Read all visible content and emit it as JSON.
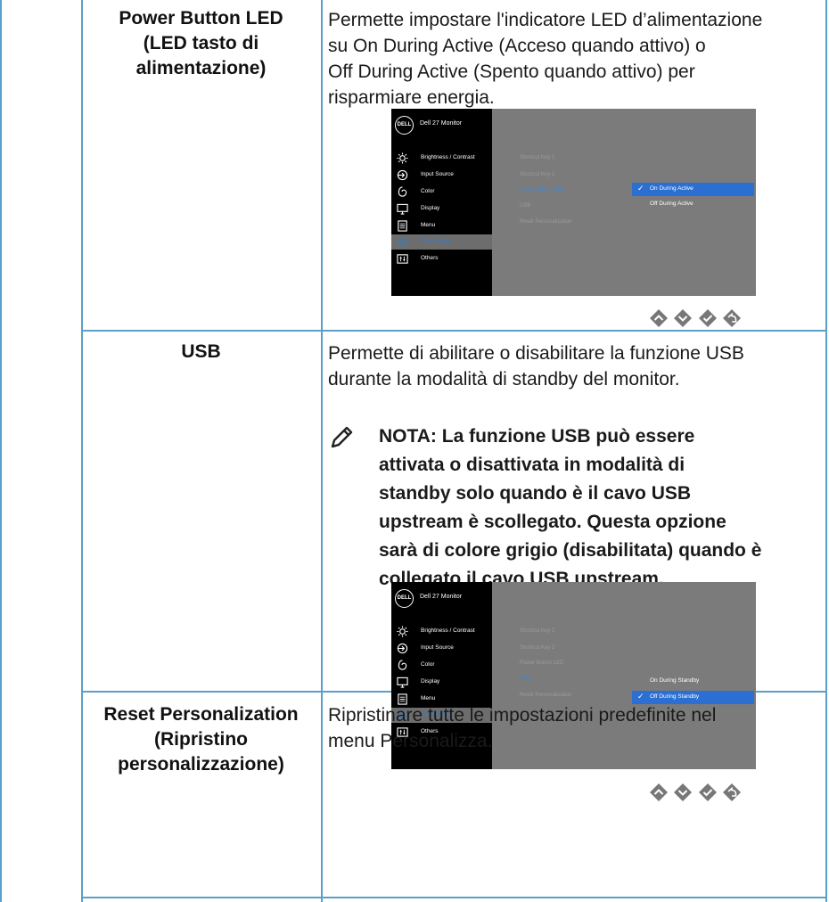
{
  "rows": [
    {
      "setting_lines": [
        "Power Button LED",
        "(LED tasto di",
        "alimentazione)"
      ],
      "desc_lines": [
        "Permette impostare l'indicatore LED d’alimentazione",
        "su On During Active (Acceso quando attivo) o",
        "Off During Active (Spento quando attivo) per",
        "risparmiare energia."
      ]
    },
    {
      "setting_lines": [
        "USB"
      ],
      "desc_lines": [
        "Permette di abilitare o disabilitare la funzione USB",
        "durante la modalità di standby del monitor."
      ],
      "note_lines": [
        "NOTA: La funzione USB può essere",
        "attivata o disattivata in modalità di",
        "standby solo quando è il cavo USB",
        "upstream è scollegato. Questa opzione",
        "sarà di colore grigio (disabilitata) quando è",
        "collegato il cavo USB upstream."
      ]
    },
    {
      "setting_lines": [
        "Reset Personalization",
        "(Ripristino",
        "personalizzazione)"
      ],
      "desc_lines": [
        "Ripristinare tutte le impostazioni predefinite nel",
        "menu Personalizza."
      ]
    }
  ],
  "osd": {
    "logo": "DELL",
    "title": "Dell 27 Monitor",
    "menu": [
      "Brightness / Contrast",
      "Input Source",
      "Color",
      "Display",
      "Menu",
      "Personalize",
      "Others"
    ],
    "menu_icons": [
      "brightness-icon",
      "input-source-icon",
      "color-icon",
      "display-icon",
      "menu-icon",
      "personalize-star-icon",
      "others-icon"
    ],
    "submenu": [
      "Shortcut Key 1",
      "Shortcut Key 2",
      "Power Button LED",
      "USB",
      "Reset Personalization"
    ],
    "screen1": {
      "active_submenu_index": 2,
      "options": [
        "On During Active",
        "Off During Active"
      ],
      "selected_option_index": 0
    },
    "screen2": {
      "active_submenu_index": 3,
      "options": [
        "On During Standby",
        "Off During Standby"
      ],
      "selected_option_index": 1
    }
  },
  "nav_icons": [
    "up-arrow-icon",
    "down-arrow-icon",
    "check-icon",
    "back-icon"
  ],
  "colors": {
    "table_line": "#5aa0c8",
    "osd_highlight": "#2a6fd1",
    "osd_active_text": "#3f86d4"
  }
}
